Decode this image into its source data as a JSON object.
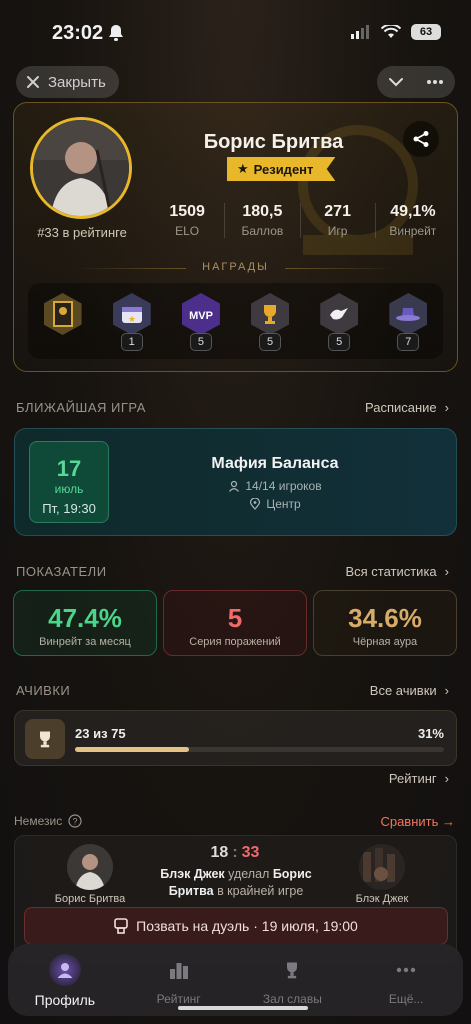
{
  "status_bar": {
    "time": "23:02",
    "battery": "63"
  },
  "top_bar": {
    "close_label": "Закрыть"
  },
  "profile": {
    "name": "Борис Бритва",
    "badge": "Резидент",
    "rank": "#33 в рейтинге",
    "stats": [
      {
        "value": "1509",
        "label": "ELO"
      },
      {
        "value": "180,5",
        "label": "Баллов"
      },
      {
        "value": "271",
        "label": "Игр"
      },
      {
        "value": "49,1%",
        "label": "Винрейт"
      }
    ],
    "awards_title": "НАГРАДЫ",
    "awards": [
      {
        "icon": "portrait-award-icon",
        "count": ""
      },
      {
        "icon": "calendar-star-icon",
        "count": "1"
      },
      {
        "icon": "mvp-icon",
        "count": "5"
      },
      {
        "icon": "trophy-icon",
        "count": "5"
      },
      {
        "icon": "dove-icon",
        "count": "5"
      },
      {
        "icon": "hat-icon",
        "count": "7"
      }
    ]
  },
  "next_game": {
    "section_title": "БЛИЖАЙШАЯ ИГРА",
    "link": "Расписание",
    "day": "17",
    "month": "июль",
    "time": "Пт, 19:30",
    "title": "Мафия Баланса",
    "players": "14/14 игроков",
    "location": "Центр"
  },
  "metrics": {
    "section_title": "ПОКАЗАТЕЛИ",
    "link": "Вся статистика",
    "items": [
      {
        "value": "47.4%",
        "label": "Винрейт за месяц"
      },
      {
        "value": "5",
        "label": "Серия поражений"
      },
      {
        "value": "34.6%",
        "label": "Чёрная аура"
      }
    ]
  },
  "achievements": {
    "section_title": "АЧИВКИ",
    "link": "Все ачивки",
    "progress_text": "23 из 75",
    "percent": "31%",
    "progress": 0.31,
    "rating_link": "Рейтинг"
  },
  "nemesis": {
    "title": "Немезис",
    "compare": "Сравнить →",
    "left_name": "Борис Бритва",
    "right_name": "Блэк Джек",
    "score_left": "18",
    "score_sep": ":",
    "score_right": "33",
    "desc_a": "Блэк Джек",
    "desc_b": " уделал ",
    "desc_c": "Борис Бритва",
    "desc_d": " в крайней игре",
    "duel": "Позвать на дуэль · 19 июля, 19:00"
  },
  "tabs": [
    {
      "label": "Профиль",
      "icon": "profile-icon"
    },
    {
      "label": "Рейтинг",
      "icon": "rating-icon"
    },
    {
      "label": "Зал славы",
      "icon": "trophy-icon"
    },
    {
      "label": "Ещё...",
      "icon": "more-icon"
    }
  ],
  "colors": {
    "accent_gold": "#e8b82a",
    "green": "#4ad58a",
    "red": "#ef6b6b",
    "sand": "#d6ad68",
    "active_tab": "#6b4fb0"
  }
}
